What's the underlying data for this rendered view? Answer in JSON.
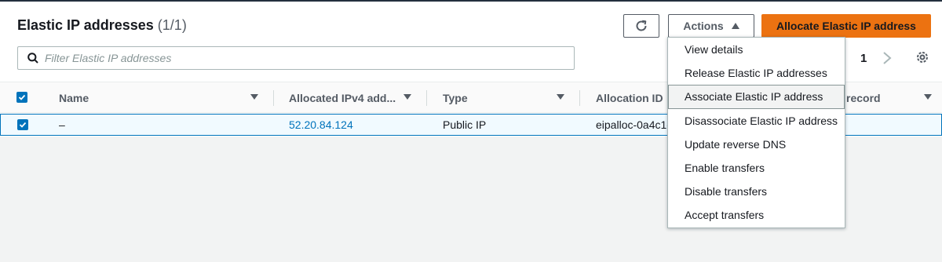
{
  "header": {
    "title": "Elastic IP addresses",
    "count": "(1/1)",
    "actions_label": "Actions",
    "allocate_label": "Allocate Elastic IP address"
  },
  "search": {
    "placeholder": "Filter Elastic IP addresses"
  },
  "pagination": {
    "current_page": "1"
  },
  "table": {
    "columns": [
      "Name",
      "Allocated IPv4 add...",
      "Type",
      "Allocation ID",
      "record"
    ],
    "rows": [
      {
        "name": "–",
        "ipv4": "52.20.84.124",
        "type": "Public IP",
        "allocation_id": "eipalloc-0a4c1c"
      }
    ]
  },
  "actions_menu": {
    "items": [
      "View details",
      "Release Elastic IP addresses",
      "Associate Elastic IP address",
      "Disassociate Elastic IP address",
      "Update reverse DNS",
      "Enable transfers",
      "Disable transfers",
      "Accept transfers"
    ],
    "highlighted_index": 2
  },
  "colors": {
    "accent": "#ec7211",
    "link": "#0073bb",
    "text": "#16191f",
    "muted": "#545b64"
  }
}
